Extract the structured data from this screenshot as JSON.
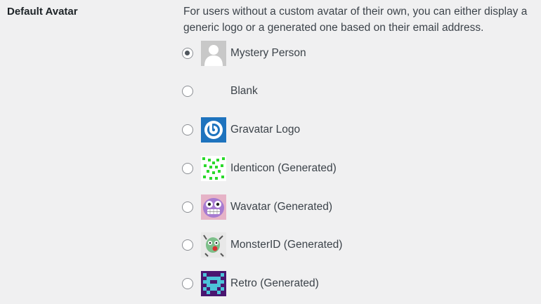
{
  "field": {
    "label": "Default Avatar",
    "description": "For users without a custom avatar of their own, you can either display a generic logo or a generated one based on their email address."
  },
  "options": [
    {
      "label": "Mystery Person",
      "selected": true,
      "icon": "mystery-person-icon"
    },
    {
      "label": "Blank",
      "selected": false,
      "icon": "blank-avatar"
    },
    {
      "label": "Gravatar Logo",
      "selected": false,
      "icon": "gravatar-logo-icon"
    },
    {
      "label": "Identicon (Generated)",
      "selected": false,
      "icon": "identicon-icon"
    },
    {
      "label": "Wavatar (Generated)",
      "selected": false,
      "icon": "wavatar-icon"
    },
    {
      "label": "MonsterID (Generated)",
      "selected": false,
      "icon": "monsterid-icon"
    },
    {
      "label": "Retro (Generated)",
      "selected": false,
      "icon": "retro-icon"
    }
  ],
  "colors": {
    "background": "#f0f0f1",
    "text": "#3c434a",
    "gravatar_blue": "#1e73be",
    "identicon_green": "#2bd92b",
    "retro_purple": "#4a1670"
  }
}
